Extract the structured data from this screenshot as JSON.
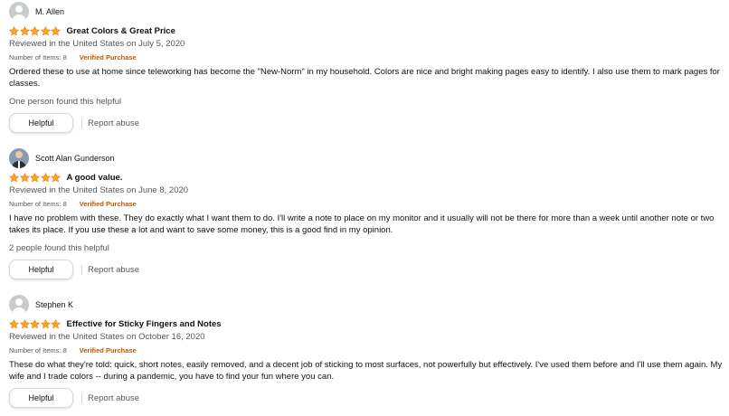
{
  "colors": {
    "star": "#FFA41C",
    "star_outline": "#DE7921",
    "verified": "#C45500",
    "muted_text": "#565959",
    "border": "#D5D9D9"
  },
  "reviews": [
    {
      "name": "M. Allen",
      "avatar": "default-avatar",
      "rating": 5,
      "title": "Great Colors & Great Price",
      "reviewed": "Reviewed in the United States on July 5, 2020",
      "items": "Number of Items: 8",
      "verified": "Verified Purchase",
      "text": "Ordered these to use at home since teleworking has become the \"New-Norm\" in my household. Colors are nice and bright making pages easy to identify. I also use them to mark pages for classes.",
      "helpful_count": "One person found this helpful",
      "helpful_label": "Helpful",
      "report_label": "Report abuse"
    },
    {
      "name": "Scott Alan Gunderson",
      "avatar": "photo-avatar",
      "rating": 5,
      "title": "A good value.",
      "reviewed": "Reviewed in the United States on June 8, 2020",
      "items": "Number of Items: 8",
      "verified": "Verified Purchase",
      "text": "I have no problem with these. They do exactly what I want them to do. I'll write a note to place on my monitor and it usually will not be there for more than a week until another note or two takes its place. If you use these a lot and want to save some money, this is a good find in my opinion.",
      "helpful_count": "2 people found this helpful",
      "helpful_label": "Helpful",
      "report_label": "Report abuse"
    },
    {
      "name": "Stephen K",
      "avatar": "default-avatar",
      "rating": 5,
      "title": "Effective for Sticky Fingers and Notes",
      "reviewed": "Reviewed in the United States on October 16, 2020",
      "items": "Number of Items: 8",
      "verified": "Verified Purchase",
      "text": "These do what they're told: quick, short notes, easily removed, and a decent job of sticking to most surfaces, not powerfully but effectively. I've used them before and I'll use them again. My wife and I trade colors -- during a pandemic, you have to find your fun where you can.",
      "helpful_label": "Helpful",
      "report_label": "Report abuse"
    }
  ]
}
